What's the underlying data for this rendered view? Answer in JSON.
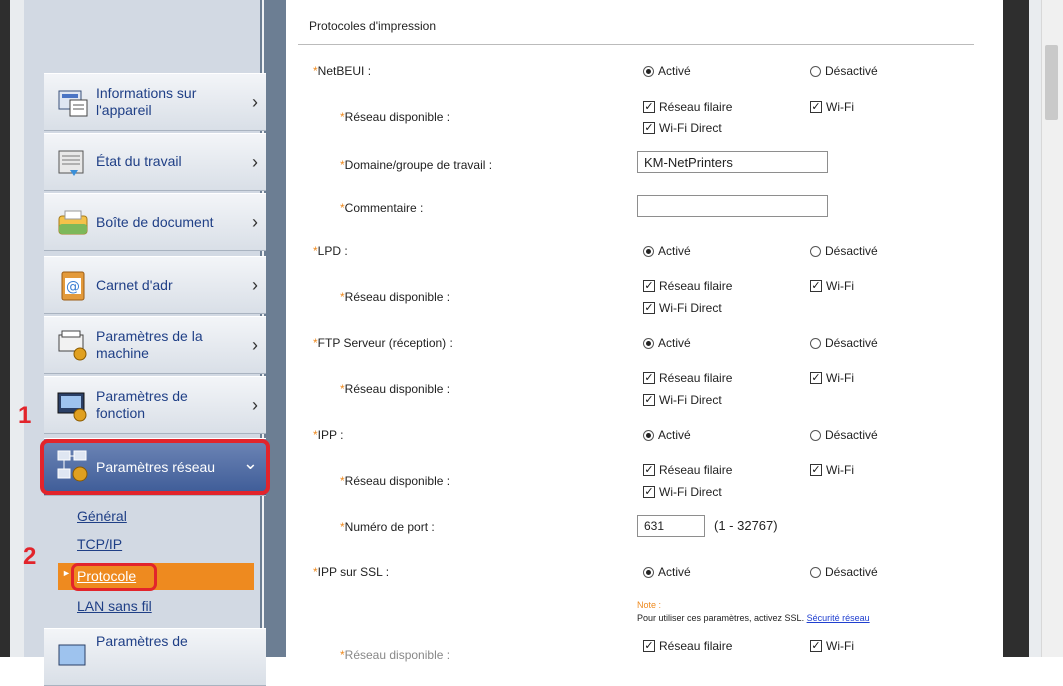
{
  "sidebar": {
    "items": [
      {
        "label_l1": "Informations sur",
        "label_l2": "l'appareil"
      },
      {
        "label": "État du travail"
      },
      {
        "label": "Boîte de document"
      },
      {
        "label": "Carnet d'adr"
      },
      {
        "label_l1": "Paramètres de la",
        "label_l2": "machine"
      },
      {
        "label_l1": "Paramètres de",
        "label_l2": "fonction"
      },
      {
        "label": "Paramètres réseau"
      },
      {
        "label_l1": "Paramètres de"
      }
    ],
    "chevron": "›",
    "chevron_open": "⌄",
    "sub": [
      "Général",
      "TCP/IP",
      "Protocole",
      "LAN sans fil"
    ],
    "callouts": [
      "1",
      "2"
    ]
  },
  "content": {
    "section_title": "Protocoles d'impression",
    "star": "*",
    "active": "Activé",
    "inactive": "Désactivé",
    "wired": "Réseau filaire",
    "wifi": "Wi-Fi",
    "wifi_direct": "Wi-Fi Direct",
    "network_available": "Réseau disponible :",
    "check_mark": "✓",
    "netbeui": "NetBEUI :",
    "domain": "Domaine/groupe de travail :",
    "domain_value": "KM-NetPrinters",
    "comment": "Commentaire :",
    "lpd": "LPD :",
    "ftp": "FTP Serveur (réception) :",
    "ipp": "IPP :",
    "port": "Numéro de port :",
    "port_value": "631",
    "port_range": "(1 - 32767)",
    "ipp_ssl": "IPP sur SSL :",
    "note_title": "Note :",
    "note_text": "Pour utiliser ces paramètres, activez SSL.",
    "note_link": "Sécurité réseau"
  },
  "colors": {
    "accent": "#ee8a1f",
    "highlight": "#e2242b",
    "link": "#1f3f86"
  }
}
